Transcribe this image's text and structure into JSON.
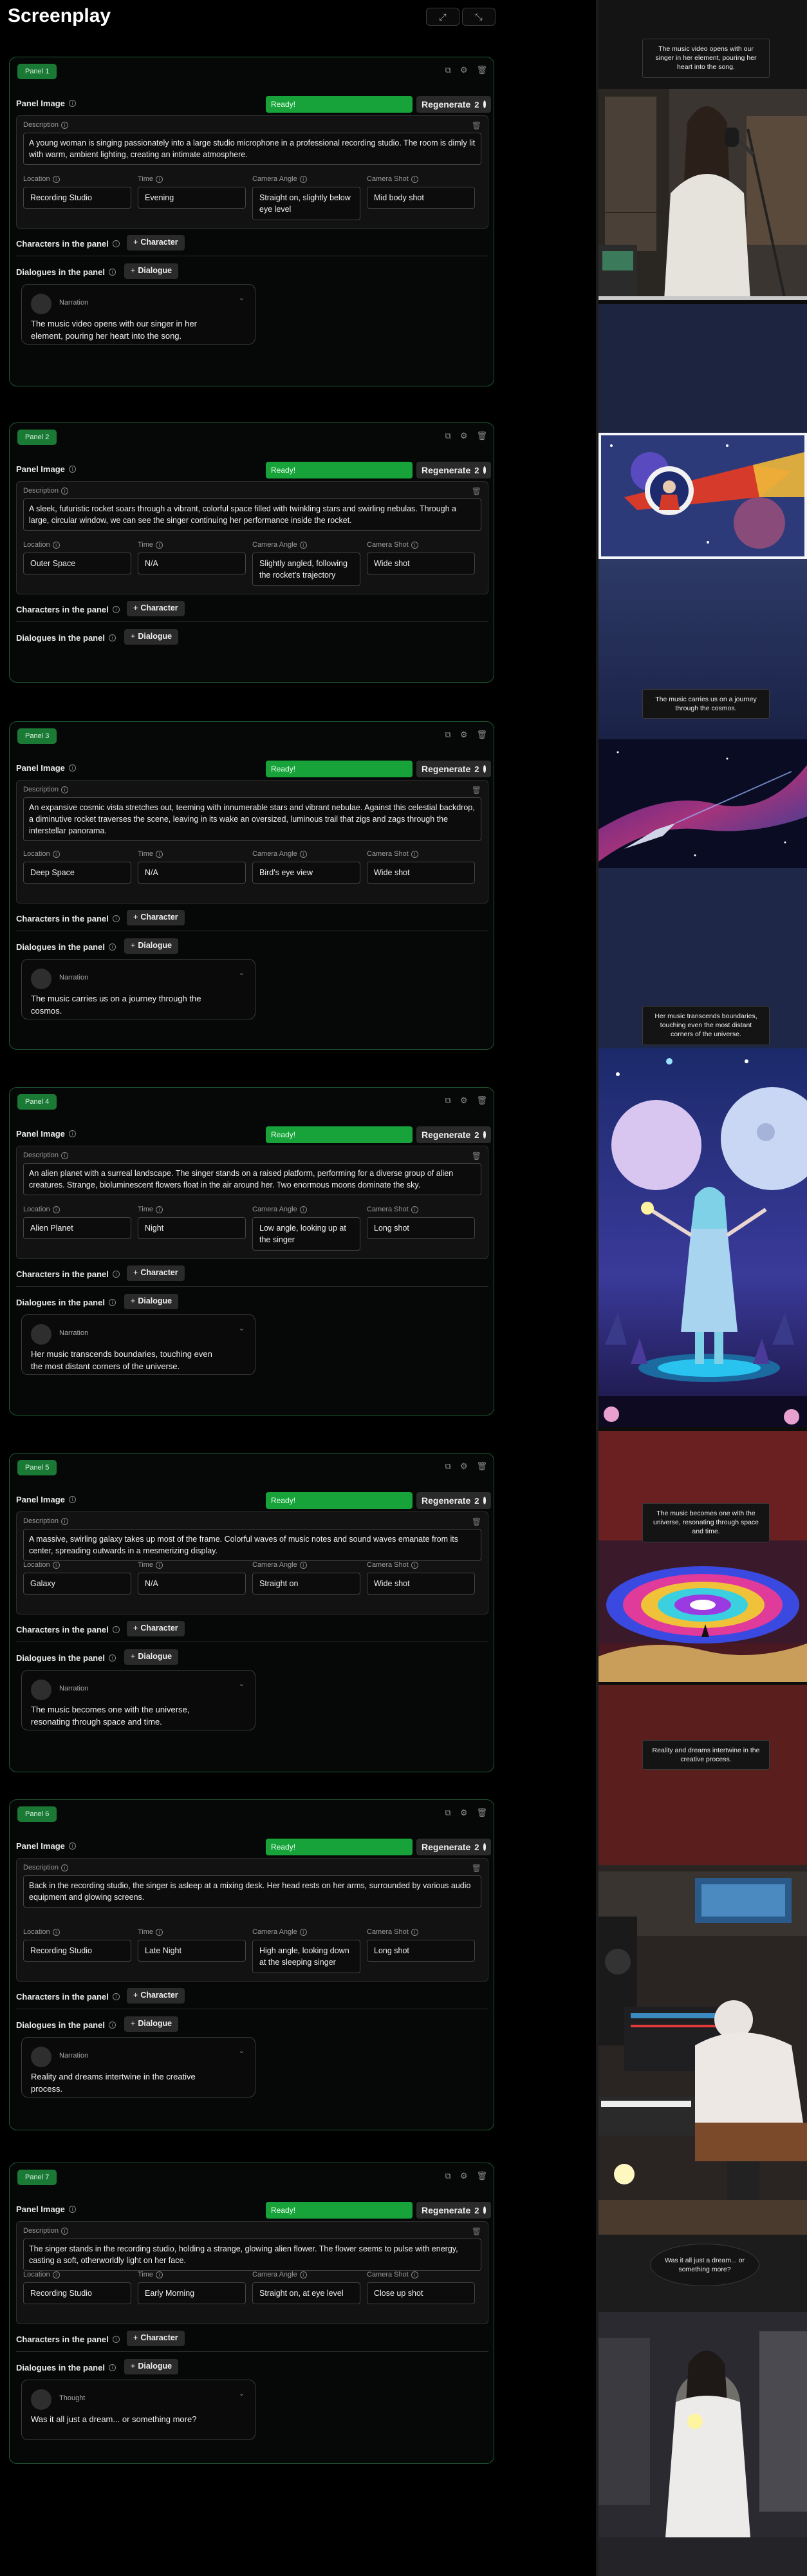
{
  "app": {
    "title": "Screenplay",
    "expand_icon": "expand-icon",
    "collapse_icon": "collapse-icon"
  },
  "labels": {
    "panel_image": "Panel Image",
    "ready": "Ready!",
    "regenerate": "Regenerate",
    "regenerate_count": "2",
    "description": "Description",
    "location": "Location",
    "time": "Time",
    "camera_angle": "Camera Angle",
    "camera_shot": "Camera Shot",
    "characters": "Characters in the panel",
    "add_character": "Character",
    "dialogues": "Dialogues in the panel",
    "add_dialogue": "Dialogue"
  },
  "colors": {
    "accent_green": "#17a33a",
    "badge_green": "#1a7a35",
    "panel_border": "#1f5a34"
  },
  "panels": [
    {
      "badge": "Panel 1",
      "description": "A young woman is singing passionately into a large studio microphone in a professional recording studio. The room is dimly lit with warm, ambient lighting, creating an intimate atmosphere.",
      "location": "Recording Studio",
      "time": "Evening",
      "camera_angle": "Straight on, slightly below eye level",
      "camera_shot": "Mid body shot",
      "dialogue": {
        "speaker": "Narration",
        "text": "The music video opens with our singer in her element, pouring her heart into the song."
      }
    },
    {
      "badge": "Panel 2",
      "description": "A sleek, futuristic rocket soars through a vibrant, colorful space filled with twinkling stars and swirling nebulas. Through a large, circular window, we can see the singer continuing her performance inside the rocket.",
      "location": "Outer Space",
      "time": "N/A",
      "camera_angle": "Slightly angled, following the rocket's trajectory",
      "camera_shot": "Wide shot",
      "dialogue": null
    },
    {
      "badge": "Panel 3",
      "description": "An expansive cosmic vista stretches out, teeming with innumerable stars and vibrant nebulae. Against this celestial backdrop, a diminutive rocket traverses the scene, leaving in its wake an oversized, luminous trail that zigs and zags through the interstellar panorama.",
      "location": "Deep Space",
      "time": "N/A",
      "camera_angle": "Bird's eye view",
      "camera_shot": "Wide shot",
      "dialogue": {
        "speaker": "Narration",
        "text": "The music carries us on a journey through the cosmos."
      }
    },
    {
      "badge": "Panel 4",
      "description": "An alien planet with a surreal landscape. The singer stands on a raised platform, performing for a diverse group of alien creatures. Strange, bioluminescent flowers float in the air around her. Two enormous moons dominate the sky.",
      "location": "Alien Planet",
      "time": "Night",
      "camera_angle": "Low angle, looking up at the singer",
      "camera_shot": "Long shot",
      "dialogue": {
        "speaker": "Narration",
        "text": "Her music transcends boundaries, touching even the most distant corners of the universe."
      }
    },
    {
      "badge": "Panel 5",
      "description": "A massive, swirling galaxy takes up most of the frame. Colorful waves of music notes and sound waves emanate from its center, spreading outwards in a mesmerizing display.",
      "location": "Galaxy",
      "time": "N/A",
      "camera_angle": "Straight on",
      "camera_shot": "Wide shot",
      "dialogue": {
        "speaker": "Narration",
        "text": "The music becomes one with the universe, resonating through space and time."
      }
    },
    {
      "badge": "Panel 6",
      "description": "Back in the recording studio, the singer is asleep at a mixing desk. Her head rests on her arms, surrounded by various audio equipment and glowing screens.",
      "location": "Recording Studio",
      "time": "Late Night",
      "camera_angle": "High angle, looking down at the sleeping singer",
      "camera_shot": "Long shot",
      "dialogue": {
        "speaker": "Narration",
        "text": "Reality and dreams intertwine in the creative process."
      }
    },
    {
      "badge": "Panel 7",
      "description": "The singer stands in the recording studio, holding a strange, glowing alien flower. The flower seems to pulse with energy, casting a soft, otherworldly light on her face.",
      "location": "Recording Studio",
      "time": "Early Morning",
      "camera_angle": "Straight on, at eye level",
      "camera_shot": "Close up shot",
      "dialogue": {
        "speaker": "Thought",
        "text": "Was it all just a dream... or something more?"
      }
    }
  ],
  "preview": {
    "captions": [
      "The music video opens with our singer in her element, pouring her heart into the song.",
      "The music carries us on a journey through the cosmos.",
      "Her music transcends boundaries, touching even the most distant corners of the universe.",
      "The music becomes one with the universe, resonating through space and time.",
      "Reality and dreams intertwine in the creative process.",
      "Was it all just a dream... or something more?"
    ]
  }
}
